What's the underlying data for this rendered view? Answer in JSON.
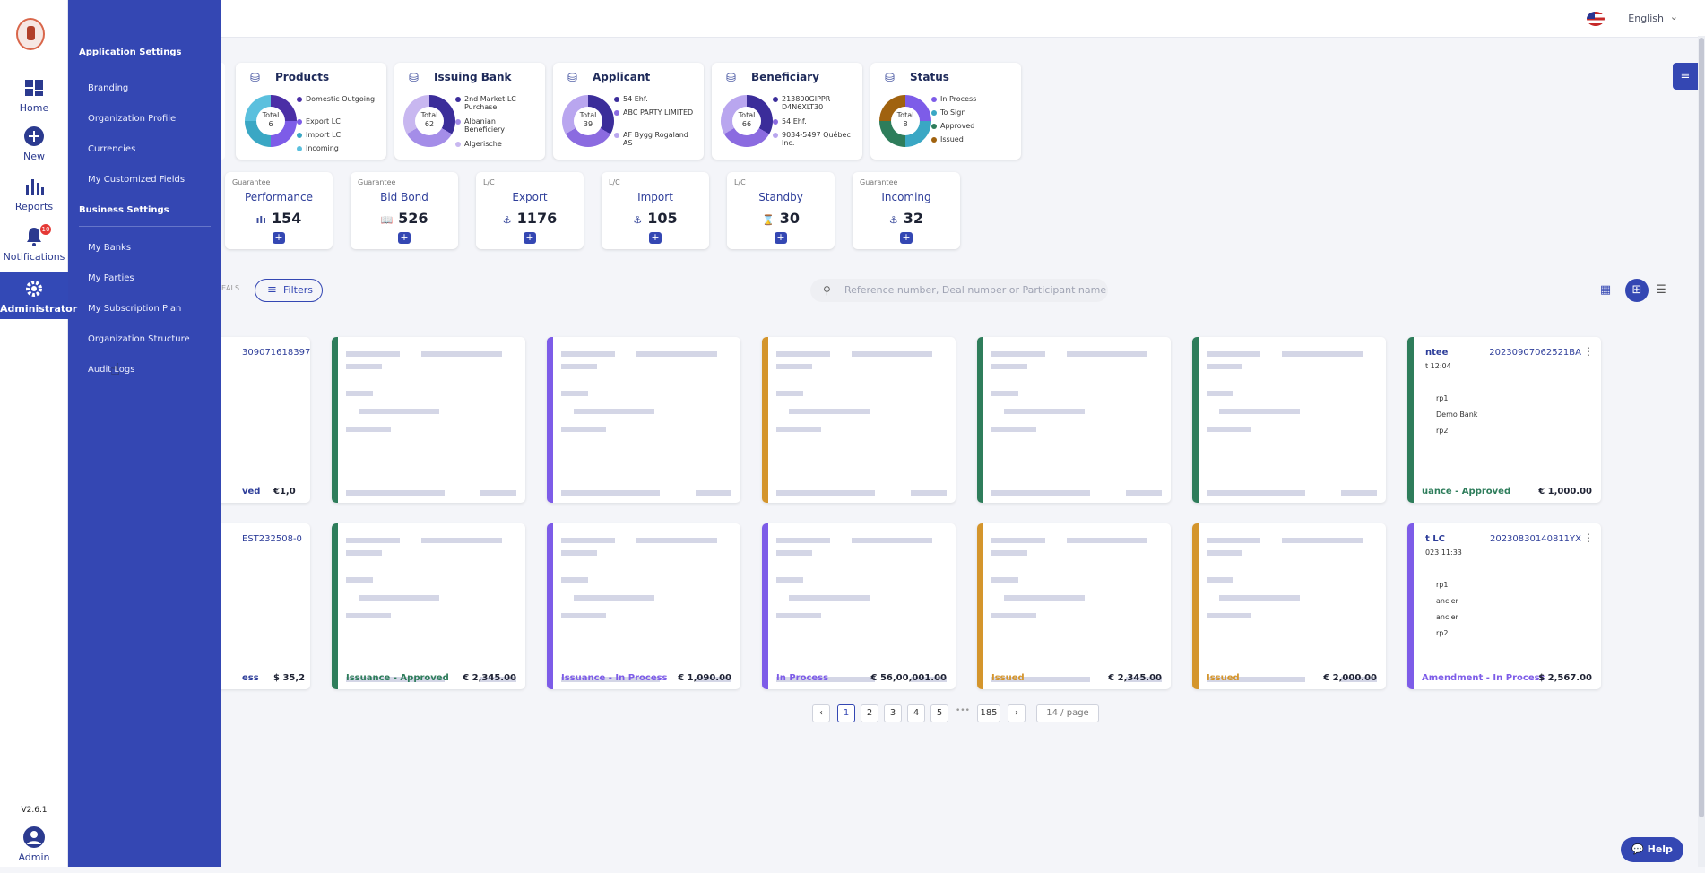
{
  "nav": {
    "items": [
      {
        "label": "Home",
        "icon": "dashboard-icon"
      },
      {
        "label": "New",
        "icon": "plus-circle-icon"
      },
      {
        "label": "Reports",
        "icon": "bar-chart-icon"
      },
      {
        "label": "Notifications",
        "icon": "bell-icon",
        "badge": "10"
      },
      {
        "label": "Administrator",
        "icon": "gear-icon"
      }
    ],
    "version": "V2.6.1",
    "user_label": "Admin"
  },
  "drawer": {
    "section1": "Application Settings",
    "section1_items": [
      "Branding",
      "Organization Profile",
      "Currencies",
      "My Customized Fields"
    ],
    "section2": "Business Settings",
    "section2_items": [
      "My Banks",
      "My Parties",
      "My Subscription Plan",
      "Organization Structure",
      "Audit Logs"
    ]
  },
  "topbar": {
    "language": "English"
  },
  "summary": [
    {
      "title": "Products",
      "total_label": "Total",
      "total": "6",
      "legend": [
        "Domestic Outgoing",
        "Export LC",
        "Import LC",
        "Incoming"
      ],
      "colors": [
        "#4b2fa6",
        "#7d5ce8",
        "#3aa7c4",
        "#5bc0de"
      ]
    },
    {
      "title": "Issuing Bank",
      "total_label": "Total",
      "total": "62",
      "legend": [
        "2nd Market LC Purchase",
        "Albanian Beneficiery",
        "Algerische"
      ],
      "colors": [
        "#3b2d9a",
        "#a48de8",
        "#c8b7f0"
      ]
    },
    {
      "title": "Applicant",
      "total_label": "Total",
      "total": "39",
      "legend": [
        "54 Ehf.",
        "ABC PARTY LIMITED",
        "AF Bygg Rogaland AS"
      ],
      "colors": [
        "#3b2d9a",
        "#8b6be0",
        "#b9a6ef"
      ]
    },
    {
      "title": "Beneficiary",
      "total_label": "Total",
      "total": "66",
      "legend": [
        "213800GIPPR D4N6XLT30",
        "54 Ehf.",
        "9034-5497 Québec Inc."
      ],
      "colors": [
        "#3b2d9a",
        "#8b6be0",
        "#b9a6ef"
      ]
    },
    {
      "title": "Status",
      "total_label": "Total",
      "total": "8",
      "legend": [
        "In Process",
        "To Sign",
        "Approved",
        "Issued"
      ],
      "colors": [
        "#7d5ce8",
        "#3aa7c4",
        "#2e7d5b",
        "#a0620f"
      ]
    }
  ],
  "types": [
    {
      "category": "Guarantee",
      "name": "Performance",
      "count": "154",
      "icon": "chart-icon"
    },
    {
      "category": "Guarantee",
      "name": "Bid Bond",
      "count": "526",
      "icon": "book-icon"
    },
    {
      "category": "L/C",
      "name": "Export",
      "count": "1176",
      "icon": "ship-icon"
    },
    {
      "category": "L/C",
      "name": "Import",
      "count": "105",
      "icon": "anchor-icon"
    },
    {
      "category": "L/C",
      "name": "Standby",
      "count": "30",
      "icon": "hourglass-icon"
    },
    {
      "category": "Guarantee",
      "name": "Incoming",
      "count": "32",
      "icon": "anchor-icon"
    }
  ],
  "toolbar": {
    "deals_tag": "EALS",
    "filters": "Filters",
    "search_placeholder": "Reference number, Deal number or Participant name"
  },
  "deals_row1": [
    {
      "ref": "309071618397",
      "status": "ved",
      "amount": "€1,0",
      "color": "#ffffff"
    },
    {
      "color": "#2e7d5b"
    },
    {
      "color": "#7d5ce8"
    },
    {
      "color": "#d4952c"
    },
    {
      "color": "#2e7d5b"
    },
    {
      "color": "#2e7d5b"
    },
    {
      "ref": "20230907062521BA",
      "title": "ntee",
      "date": "t 12:04",
      "lines": [
        "rp1",
        "Demo Bank",
        "rp2"
      ],
      "status": "uance - Approved",
      "amount": "€ 1,000.00",
      "color": "#2e7d5b"
    }
  ],
  "deals_row2": [
    {
      "ref": "EST232508-0",
      "status": "ess",
      "amount": "$ 35,2",
      "color": "#ffffff"
    },
    {
      "status": "Issuance - Approved",
      "amount": "€ 2,345.00",
      "color": "#2e7d5b"
    },
    {
      "status": "Issuance - In Process",
      "amount": "€ 1,090.00",
      "color": "#7d5ce8"
    },
    {
      "status": "In Process",
      "amount": "€ 56,00,001.00",
      "color": "#7d5ce8"
    },
    {
      "status": "Issued",
      "amount": "€ 2,345.00",
      "color": "#d4952c"
    },
    {
      "status": "Issued",
      "amount": "€ 2,000.00",
      "color": "#d4952c"
    },
    {
      "ref": "20230830140811YX",
      "title": "t LC",
      "date": "023 11:33",
      "lines": [
        "rp1",
        "ancier",
        "ancier",
        "rp2"
      ],
      "status": "Amendment - In Process",
      "amount": "$ 2,567.00",
      "color": "#7d5ce8"
    }
  ],
  "pagination": {
    "pages": [
      "1",
      "2",
      "3",
      "4",
      "5"
    ],
    "ellipsis": "•••",
    "last": "185",
    "per_page": "14 / page"
  },
  "help": "Help"
}
